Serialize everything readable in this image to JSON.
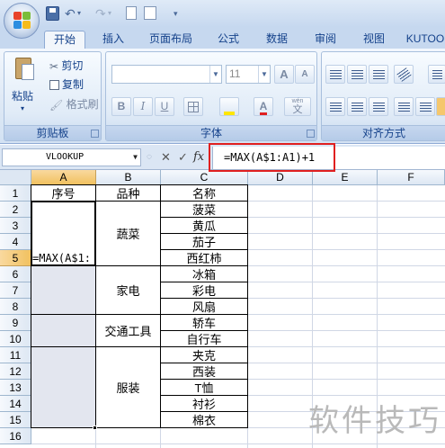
{
  "ribbon_tabs": [
    "开始",
    "插入",
    "页面布局",
    "公式",
    "数据",
    "审阅",
    "视图",
    "KUTOO"
  ],
  "clipboard": {
    "paste": "粘贴",
    "cut": "剪切",
    "copy": "复制",
    "format_painter": "格式刷",
    "label": "剪贴板"
  },
  "font_group": {
    "font_size": "11",
    "grow": "A",
    "shrink": "A",
    "bold": "B",
    "italic": "I",
    "underline": "U",
    "label": "字体",
    "wen": "wén",
    "zi": "文"
  },
  "alignment_group": {
    "label": "对齐方式"
  },
  "formula_bar": {
    "name_box": "VLOOKUP",
    "cancel": "✕",
    "enter": "✓",
    "fx": "fx",
    "formula": "=MAX(A$1:A1)+1"
  },
  "columns": [
    "A",
    "B",
    "C",
    "D",
    "E",
    "F"
  ],
  "rows": [
    "1",
    "2",
    "3",
    "4",
    "5",
    "6",
    "7",
    "8",
    "9",
    "10",
    "11",
    "12",
    "13",
    "14",
    "15",
    "16"
  ],
  "headers": {
    "a": "序号",
    "b": "品种",
    "c": "名称"
  },
  "categories": [
    "蔬菜",
    "家电",
    "交通工具",
    "服装"
  ],
  "names": [
    "菠菜",
    "黄瓜",
    "茄子",
    "西红柿",
    "冰箱",
    "彩电",
    "风扇",
    "轿车",
    "自行车",
    "夹克",
    "西装",
    "T恤",
    "衬衫",
    "棉衣"
  ],
  "active_cell_text": "=MAX(A$1:",
  "watermark": "软件技巧",
  "colors": {
    "formula_highlight": "#e02020",
    "selection": "#e3e6ef"
  }
}
